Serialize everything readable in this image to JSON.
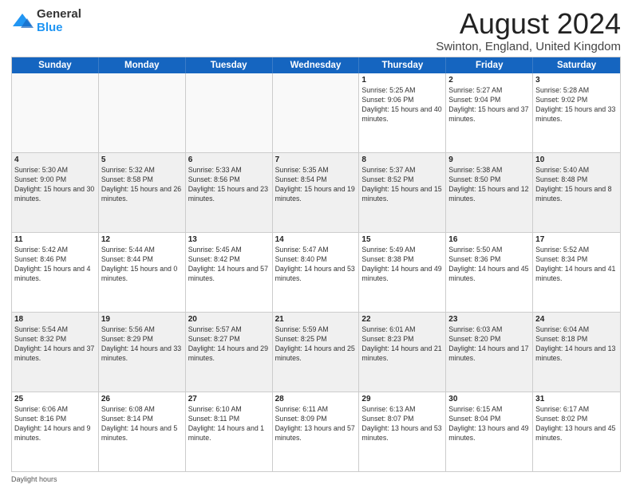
{
  "logo": {
    "general": "General",
    "blue": "Blue"
  },
  "title": "August 2024",
  "subtitle": "Swinton, England, United Kingdom",
  "days": [
    "Sunday",
    "Monday",
    "Tuesday",
    "Wednesday",
    "Thursday",
    "Friday",
    "Saturday"
  ],
  "footer_label": "Daylight hours",
  "weeks": [
    [
      {
        "day": "",
        "sunrise": "",
        "sunset": "",
        "daylight": ""
      },
      {
        "day": "",
        "sunrise": "",
        "sunset": "",
        "daylight": ""
      },
      {
        "day": "",
        "sunrise": "",
        "sunset": "",
        "daylight": ""
      },
      {
        "day": "",
        "sunrise": "",
        "sunset": "",
        "daylight": ""
      },
      {
        "day": "1",
        "sunrise": "Sunrise: 5:25 AM",
        "sunset": "Sunset: 9:06 PM",
        "daylight": "Daylight: 15 hours and 40 minutes."
      },
      {
        "day": "2",
        "sunrise": "Sunrise: 5:27 AM",
        "sunset": "Sunset: 9:04 PM",
        "daylight": "Daylight: 15 hours and 37 minutes."
      },
      {
        "day": "3",
        "sunrise": "Sunrise: 5:28 AM",
        "sunset": "Sunset: 9:02 PM",
        "daylight": "Daylight: 15 hours and 33 minutes."
      }
    ],
    [
      {
        "day": "4",
        "sunrise": "Sunrise: 5:30 AM",
        "sunset": "Sunset: 9:00 PM",
        "daylight": "Daylight: 15 hours and 30 minutes."
      },
      {
        "day": "5",
        "sunrise": "Sunrise: 5:32 AM",
        "sunset": "Sunset: 8:58 PM",
        "daylight": "Daylight: 15 hours and 26 minutes."
      },
      {
        "day": "6",
        "sunrise": "Sunrise: 5:33 AM",
        "sunset": "Sunset: 8:56 PM",
        "daylight": "Daylight: 15 hours and 23 minutes."
      },
      {
        "day": "7",
        "sunrise": "Sunrise: 5:35 AM",
        "sunset": "Sunset: 8:54 PM",
        "daylight": "Daylight: 15 hours and 19 minutes."
      },
      {
        "day": "8",
        "sunrise": "Sunrise: 5:37 AM",
        "sunset": "Sunset: 8:52 PM",
        "daylight": "Daylight: 15 hours and 15 minutes."
      },
      {
        "day": "9",
        "sunrise": "Sunrise: 5:38 AM",
        "sunset": "Sunset: 8:50 PM",
        "daylight": "Daylight: 15 hours and 12 minutes."
      },
      {
        "day": "10",
        "sunrise": "Sunrise: 5:40 AM",
        "sunset": "Sunset: 8:48 PM",
        "daylight": "Daylight: 15 hours and 8 minutes."
      }
    ],
    [
      {
        "day": "11",
        "sunrise": "Sunrise: 5:42 AM",
        "sunset": "Sunset: 8:46 PM",
        "daylight": "Daylight: 15 hours and 4 minutes."
      },
      {
        "day": "12",
        "sunrise": "Sunrise: 5:44 AM",
        "sunset": "Sunset: 8:44 PM",
        "daylight": "Daylight: 15 hours and 0 minutes."
      },
      {
        "day": "13",
        "sunrise": "Sunrise: 5:45 AM",
        "sunset": "Sunset: 8:42 PM",
        "daylight": "Daylight: 14 hours and 57 minutes."
      },
      {
        "day": "14",
        "sunrise": "Sunrise: 5:47 AM",
        "sunset": "Sunset: 8:40 PM",
        "daylight": "Daylight: 14 hours and 53 minutes."
      },
      {
        "day": "15",
        "sunrise": "Sunrise: 5:49 AM",
        "sunset": "Sunset: 8:38 PM",
        "daylight": "Daylight: 14 hours and 49 minutes."
      },
      {
        "day": "16",
        "sunrise": "Sunrise: 5:50 AM",
        "sunset": "Sunset: 8:36 PM",
        "daylight": "Daylight: 14 hours and 45 minutes."
      },
      {
        "day": "17",
        "sunrise": "Sunrise: 5:52 AM",
        "sunset": "Sunset: 8:34 PM",
        "daylight": "Daylight: 14 hours and 41 minutes."
      }
    ],
    [
      {
        "day": "18",
        "sunrise": "Sunrise: 5:54 AM",
        "sunset": "Sunset: 8:32 PM",
        "daylight": "Daylight: 14 hours and 37 minutes."
      },
      {
        "day": "19",
        "sunrise": "Sunrise: 5:56 AM",
        "sunset": "Sunset: 8:29 PM",
        "daylight": "Daylight: 14 hours and 33 minutes."
      },
      {
        "day": "20",
        "sunrise": "Sunrise: 5:57 AM",
        "sunset": "Sunset: 8:27 PM",
        "daylight": "Daylight: 14 hours and 29 minutes."
      },
      {
        "day": "21",
        "sunrise": "Sunrise: 5:59 AM",
        "sunset": "Sunset: 8:25 PM",
        "daylight": "Daylight: 14 hours and 25 minutes."
      },
      {
        "day": "22",
        "sunrise": "Sunrise: 6:01 AM",
        "sunset": "Sunset: 8:23 PM",
        "daylight": "Daylight: 14 hours and 21 minutes."
      },
      {
        "day": "23",
        "sunrise": "Sunrise: 6:03 AM",
        "sunset": "Sunset: 8:20 PM",
        "daylight": "Daylight: 14 hours and 17 minutes."
      },
      {
        "day": "24",
        "sunrise": "Sunrise: 6:04 AM",
        "sunset": "Sunset: 8:18 PM",
        "daylight": "Daylight: 14 hours and 13 minutes."
      }
    ],
    [
      {
        "day": "25",
        "sunrise": "Sunrise: 6:06 AM",
        "sunset": "Sunset: 8:16 PM",
        "daylight": "Daylight: 14 hours and 9 minutes."
      },
      {
        "day": "26",
        "sunrise": "Sunrise: 6:08 AM",
        "sunset": "Sunset: 8:14 PM",
        "daylight": "Daylight: 14 hours and 5 minutes."
      },
      {
        "day": "27",
        "sunrise": "Sunrise: 6:10 AM",
        "sunset": "Sunset: 8:11 PM",
        "daylight": "Daylight: 14 hours and 1 minute."
      },
      {
        "day": "28",
        "sunrise": "Sunrise: 6:11 AM",
        "sunset": "Sunset: 8:09 PM",
        "daylight": "Daylight: 13 hours and 57 minutes."
      },
      {
        "day": "29",
        "sunrise": "Sunrise: 6:13 AM",
        "sunset": "Sunset: 8:07 PM",
        "daylight": "Daylight: 13 hours and 53 minutes."
      },
      {
        "day": "30",
        "sunrise": "Sunrise: 6:15 AM",
        "sunset": "Sunset: 8:04 PM",
        "daylight": "Daylight: 13 hours and 49 minutes."
      },
      {
        "day": "31",
        "sunrise": "Sunrise: 6:17 AM",
        "sunset": "Sunset: 8:02 PM",
        "daylight": "Daylight: 13 hours and 45 minutes."
      }
    ]
  ]
}
